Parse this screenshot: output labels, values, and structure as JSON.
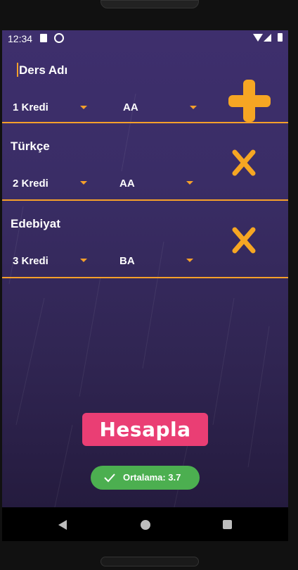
{
  "status": {
    "time": "12:34"
  },
  "form": {
    "course_placeholder": "Ders Adı",
    "credit_selected": "1 Kredi",
    "grade_selected": "AA"
  },
  "courses": [
    {
      "name": "Türkçe",
      "credit": "2 Kredi",
      "grade": "AA"
    },
    {
      "name": "Edebiyat",
      "credit": "3 Kredi",
      "grade": "BA"
    }
  ],
  "actions": {
    "calculate_label": "Hesapla"
  },
  "toast": {
    "message": "Ortalama: 3.7"
  },
  "icons": {
    "add": "plus-icon",
    "delete": "close-icon",
    "dropdown": "triangle-down-icon",
    "toast": "check-icon"
  },
  "colors": {
    "accent": "#f6a02a",
    "button": "#ea3e74",
    "toast": "#4caf50"
  }
}
